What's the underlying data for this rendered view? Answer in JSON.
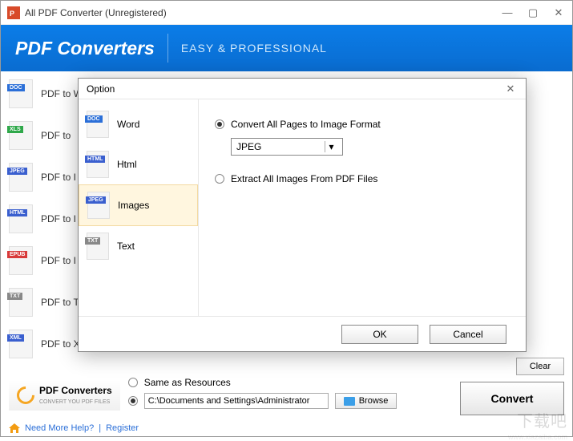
{
  "window": {
    "title": "All PDF Converter (Unregistered)"
  },
  "banner": {
    "title": "PDF Converters",
    "subtitle": "EASY & PROFESSIONAL"
  },
  "sidebar_formats": [
    {
      "label": "PDF to W",
      "badge": "DOC",
      "badgeClass": "b-doc"
    },
    {
      "label": "PDF to",
      "badge": "XLS",
      "badgeClass": "b-xls"
    },
    {
      "label": "PDF to I",
      "badge": "JPEG",
      "badgeClass": "b-jpeg"
    },
    {
      "label": "PDF to I",
      "badge": "HTML",
      "badgeClass": "b-html"
    },
    {
      "label": "PDF to I",
      "badge": "EPUB",
      "badgeClass": "b-epub"
    },
    {
      "label": "PDF to T",
      "badge": "TXT",
      "badgeClass": "b-txt"
    },
    {
      "label": "PDF to X",
      "badge": "XML",
      "badgeClass": "b-xml"
    }
  ],
  "modal": {
    "title": "Option",
    "tabs": [
      {
        "label": "Word",
        "badge": "DOC",
        "badgeClass": "b-doc"
      },
      {
        "label": "Html",
        "badge": "HTML",
        "badgeClass": "b-html"
      },
      {
        "label": "Images",
        "badge": "JPEG",
        "badgeClass": "b-jpeg"
      },
      {
        "label": "Text",
        "badge": "TXT",
        "badgeClass": "b-txt"
      }
    ],
    "active_tab_index": 2,
    "opt_convert_all": "Convert All Pages to Image Format",
    "opt_extract": "Extract All Images From PDF Files",
    "format_selected": "JPEG",
    "ok": "OK",
    "cancel": "Cancel"
  },
  "output": {
    "same_as_resources": "Same as Resources",
    "path": "C:\\Documents and Settings\\Administrator",
    "browse": "Browse",
    "convert": "Convert",
    "clear": "Clear"
  },
  "brand": {
    "name": "PDF Converters",
    "tag": "CONVERT YOU PDF FILES"
  },
  "help": {
    "need_more": "Need More Help?",
    "register": "Register"
  },
  "watermark": "下载吧",
  "watermark_sub": "www.xiazaiba.com"
}
